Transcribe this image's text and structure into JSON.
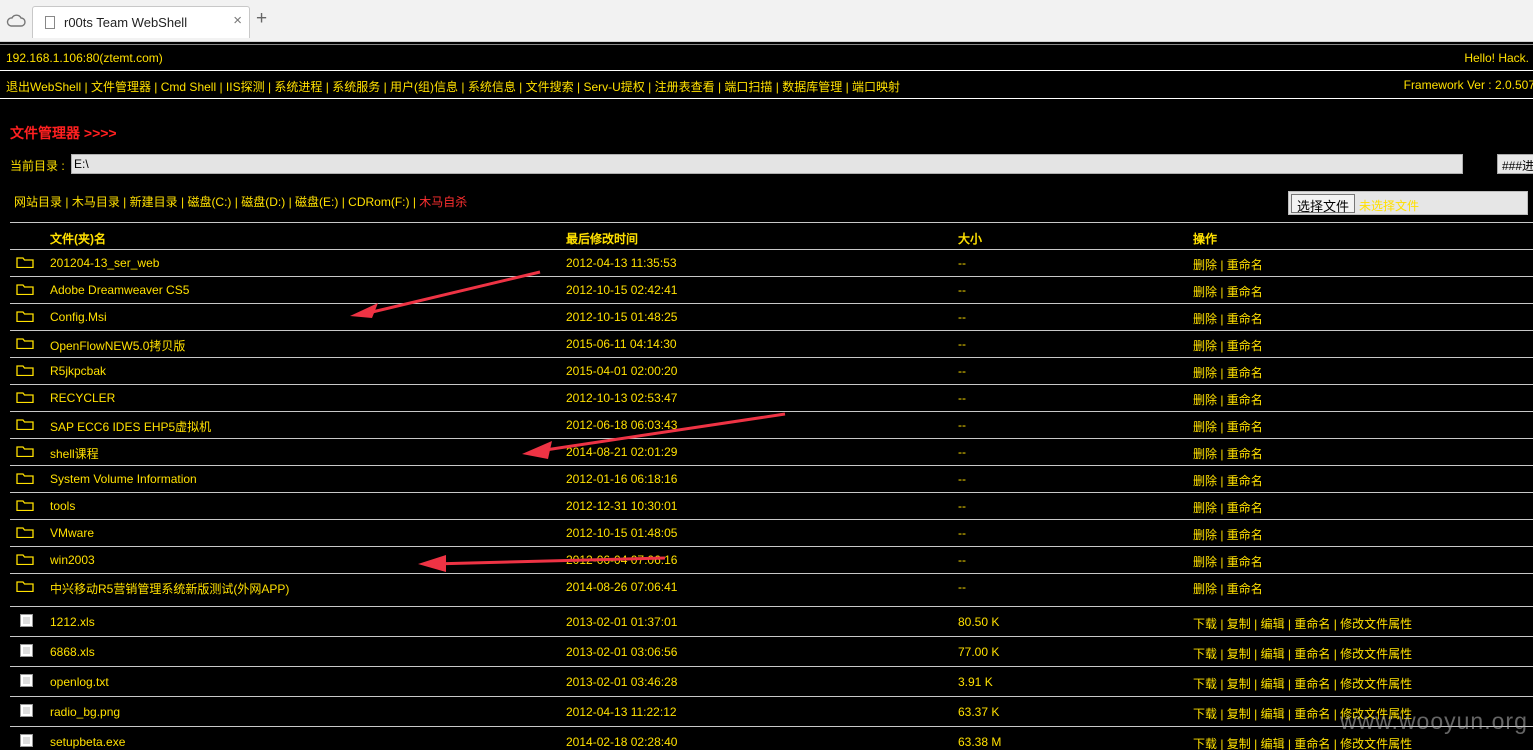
{
  "browser": {
    "tab_title": "r00ts Team WebShell",
    "close_symbol": "×",
    "new_tab_symbol": "+"
  },
  "header": {
    "server": "192.168.1.106:80(ztemt.com)",
    "greeting": "Hello! Hack."
  },
  "menu": {
    "items": [
      "退出WebShell",
      "文件管理器",
      "Cmd Shell",
      "IIS探测",
      "系统进程",
      "系统服务",
      "用户(组)信息",
      "系统信息",
      "文件搜索",
      "Serv-U提权",
      "注册表查看",
      "端口扫描",
      "数据库管理",
      "端口映射"
    ],
    "framework": "Framework Ver : 2.0.507"
  },
  "section_title": "文件管理器 >>>>",
  "current_dir": {
    "label": "当前目录 :",
    "value": "E:\\",
    "go_label": "###进"
  },
  "quick_links": {
    "items": [
      "网站目录",
      "木马目录",
      "新建目录",
      "磁盘(C:)",
      "磁盘(D:)",
      "磁盘(E:)",
      "CDRom(F:)"
    ],
    "danger": "木马自杀"
  },
  "upload": {
    "choose_label": "选择文件",
    "status": "未选择文件"
  },
  "table": {
    "headers": {
      "name": "文件(夹)名",
      "time": "最后修改时间",
      "size": "大小",
      "ops": "操作"
    },
    "folder_ops": "删除 | 重命名",
    "file_ops": "下载 | 复制 | 编辑 | 重命名 | 修改文件属性",
    "folders": [
      {
        "name": "201204-13_ser_web",
        "time": "2012-04-13 11:35:53",
        "size": "--"
      },
      {
        "name": "Adobe Dreamweaver CS5",
        "time": "2012-10-15 02:42:41",
        "size": "--"
      },
      {
        "name": "Config.Msi",
        "time": "2012-10-15 01:48:25",
        "size": "--"
      },
      {
        "name": "OpenFlowNEW5.0拷贝版",
        "time": "2015-06-11 04:14:30",
        "size": "--"
      },
      {
        "name": "R5jkpcbak",
        "time": "2015-04-01 02:00:20",
        "size": "--"
      },
      {
        "name": "RECYCLER",
        "time": "2012-10-13 02:53:47",
        "size": "--"
      },
      {
        "name": "SAP ECC6 IDES EHP5虚拟机",
        "time": "2012-06-18 06:03:43",
        "size": "--"
      },
      {
        "name": "shell课程",
        "time": "2014-08-21 02:01:29",
        "size": "--"
      },
      {
        "name": "System Volume Information",
        "time": "2012-01-16 06:18:16",
        "size": "--"
      },
      {
        "name": "tools",
        "time": "2012-12-31 10:30:01",
        "size": "--"
      },
      {
        "name": "VMware",
        "time": "2012-10-15 01:48:05",
        "size": "--"
      },
      {
        "name": "win2003",
        "time": "2012-06-04 07:06:16",
        "size": "--"
      },
      {
        "name": "中兴移动R5营销管理系统新版测试(外网APP)",
        "time": "2014-08-26 07:06:41",
        "size": "--"
      }
    ],
    "files": [
      {
        "name": "1212.xls",
        "time": "2013-02-01 01:37:01",
        "size": "80.50 K"
      },
      {
        "name": "6868.xls",
        "time": "2013-02-01 03:06:56",
        "size": "77.00 K"
      },
      {
        "name": "openlog.txt",
        "time": "2013-02-01 03:46:28",
        "size": "3.91 K"
      },
      {
        "name": "radio_bg.png",
        "time": "2012-04-13 11:22:12",
        "size": "63.37 K"
      },
      {
        "name": "setupbeta.exe",
        "time": "2014-02-18 02:28:40",
        "size": "63.38 M"
      }
    ]
  },
  "watermark": "www.wooyun.org",
  "colors": {
    "text": "#ffe000",
    "background": "#000000",
    "accent": "#ff2020",
    "annotation": "#ee3344"
  }
}
